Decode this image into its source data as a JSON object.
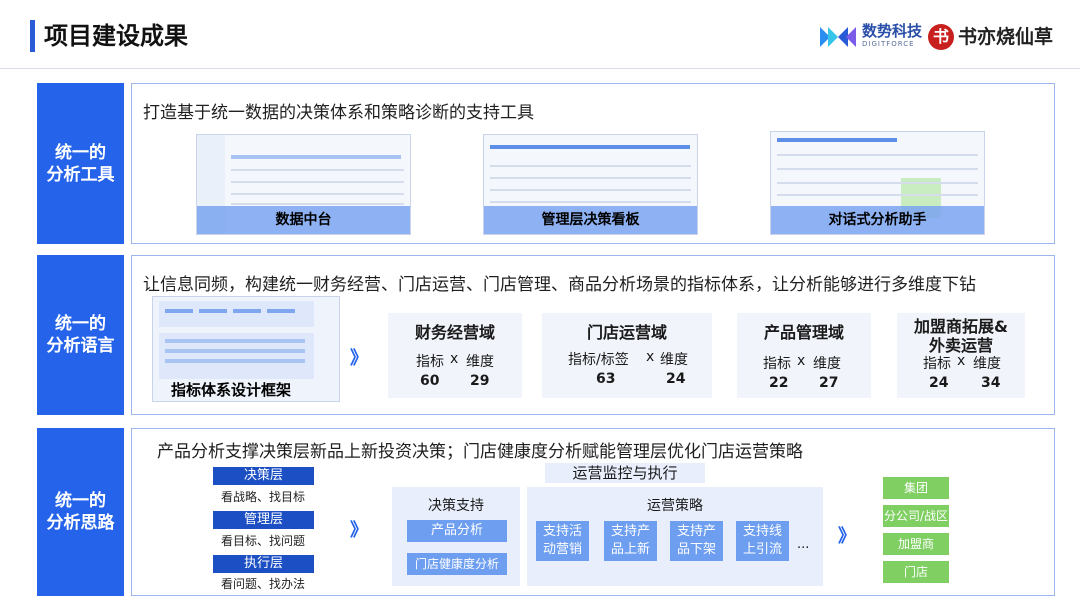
{
  "header": {
    "title": "项目建设成果",
    "logo_digitforce_name": "数势科技",
    "logo_digitforce_sub": "DIGITFORCE",
    "logo_shuyi_mark": "书",
    "logo_shuyi_name": "书亦烧仙草"
  },
  "colors": {
    "accent": "#2563eb",
    "panel_border": "#9db7ec",
    "green": "#7fcf62"
  },
  "section1": {
    "label": "统一的\n分析工具",
    "heading": "打造基于统一数据的决策体系和策略诊断的支持工具",
    "tools": [
      {
        "caption": "数据中台"
      },
      {
        "caption": "管理层决策看板"
      },
      {
        "caption": "对话式分析助手"
      }
    ]
  },
  "section2": {
    "label": "统一的\n分析语言",
    "heading": "让信息同频，构建统一财务经营、门店运营、门店管理、商品分析场景的指标体系，让分析能够进行多维度下钻",
    "framework_caption": "指标体系设计框架",
    "arrow": "》",
    "domains": [
      {
        "title": "财务经营域",
        "metric_label": "指标",
        "x": "x",
        "dim_label": "维度",
        "metric_count": "60",
        "dim_count": "29"
      },
      {
        "title": "门店运营域",
        "metric_label": "指标/标签",
        "x": "x",
        "dim_label": "维度",
        "metric_count": "63",
        "dim_count": "24"
      },
      {
        "title": "产品管理域",
        "metric_label": "指标",
        "x": "x",
        "dim_label": "维度",
        "metric_count": "22",
        "dim_count": "27"
      },
      {
        "title": "加盟商拓展&\n外卖运营",
        "metric_label": "指标",
        "x": "x",
        "dim_label": "维度",
        "metric_count": "24",
        "dim_count": "34"
      }
    ]
  },
  "section3": {
    "label": "统一的\n分析思路",
    "heading": "产品分析支撑决策层新品上新投资决策；门店健康度分析赋能管理层优化门店运营策略",
    "layers": [
      {
        "name": "决策层",
        "desc": "看战略、找目标"
      },
      {
        "name": "管理层",
        "desc": "看目标、找问题"
      },
      {
        "name": "执行层",
        "desc": "看问题、找办法"
      }
    ],
    "arrow1": "》",
    "decision_support": {
      "title": "决策支持",
      "items": [
        "产品分析",
        "门店健康度分析"
      ]
    },
    "monitoring_title": "运营监控与执行",
    "strategy": {
      "title": "运营策略",
      "items": [
        "支持活\n动营销",
        "支持产\n品上新",
        "支持产\n品下架",
        "支持线\n上引流"
      ],
      "ellipsis": "..."
    },
    "arrow2": "》",
    "orgs": [
      "集团",
      "分公司/战区",
      "加盟商",
      "门店"
    ]
  }
}
